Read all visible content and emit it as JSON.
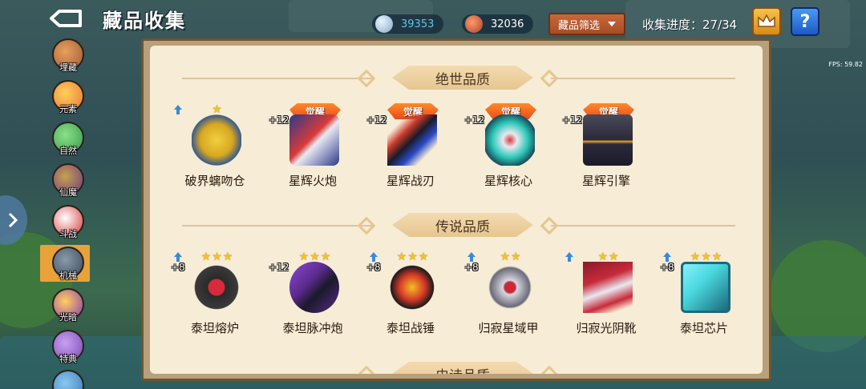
{
  "header": {
    "title": "藏品收集",
    "currency_1": {
      "value": "39353",
      "color": "#5dc6e8",
      "icon": "ore-icon"
    },
    "currency_2": {
      "value": "32036",
      "color": "#ffffff",
      "icon": "meat-icon"
    },
    "filter_label": "藏品筛选",
    "progress_label": "收集进度：27/34",
    "fps": "FPS: 59.82"
  },
  "sidebar": {
    "items": [
      {
        "label": "埋藏",
        "color": "#a05a3a"
      },
      {
        "label": "元素",
        "color": "#e8743a"
      },
      {
        "label": "自然",
        "color": "#3a9a4a"
      },
      {
        "label": "仙魔",
        "color": "#6a3a8a"
      },
      {
        "label": "斗战",
        "color": "#d83a3a"
      },
      {
        "label": "机械",
        "color": "#3a4a5a",
        "active": true
      },
      {
        "label": "光暗",
        "color": "#8a3ab8"
      },
      {
        "label": "特典",
        "color": "#7a4ab8"
      },
      {
        "label": "",
        "color": "#3a7ab8"
      }
    ]
  },
  "sections": [
    {
      "title": "绝世品质",
      "items": [
        {
          "name": "破界螭吻仓",
          "level": "",
          "awake": "",
          "stars": "★",
          "color": "#d8a820",
          "accent": "#3a5a8a"
        },
        {
          "name": "星辉火炮",
          "level": "+12",
          "awake": "觉醒",
          "stars": "",
          "color": "#2a3a8a",
          "accent": "#d83a3a"
        },
        {
          "name": "星辉战刃",
          "level": "+12",
          "awake": "觉醒",
          "stars": "",
          "color": "#c83a2a",
          "accent": "#2a4ac8"
        },
        {
          "name": "星辉核心",
          "level": "+12",
          "awake": "觉醒",
          "stars": "",
          "color": "#2ac8b8",
          "accent": "#d8d8e8"
        },
        {
          "name": "星辉引擎",
          "level": "+12",
          "awake": "觉醒",
          "stars": "",
          "color": "#2a2a3a",
          "accent": "#f0a020"
        }
      ]
    },
    {
      "title": "传说品质",
      "items": [
        {
          "name": "泰坦熔炉",
          "level": "+8",
          "awake": "",
          "stars": "★★★",
          "color": "#2a2a2a",
          "accent": "#d82a3a"
        },
        {
          "name": "泰坦脉冲炮",
          "level": "+12",
          "awake": "",
          "stars": "★★★",
          "color": "#5a2a8a",
          "accent": "#1a1a2a"
        },
        {
          "name": "泰坦战锤",
          "level": "+8",
          "awake": "",
          "stars": "★★★",
          "color": "#d83a2a",
          "accent": "#f0c020"
        },
        {
          "name": "归寂星域甲",
          "level": "+8",
          "awake": "",
          "stars": "★★",
          "color": "#d8d8e0",
          "accent": "#c82a3a"
        },
        {
          "name": "归寂光阴靴",
          "level": "",
          "awake": "",
          "stars": "★★",
          "color": "#c82a3a",
          "accent": "#e8e8f0"
        },
        {
          "name": "泰坦芯片",
          "level": "+8",
          "awake": "",
          "stars": "★★★",
          "color": "#4ad8e0",
          "accent": "#1a6a7a"
        }
      ]
    },
    {
      "title": "史诗品质",
      "items": []
    }
  ]
}
